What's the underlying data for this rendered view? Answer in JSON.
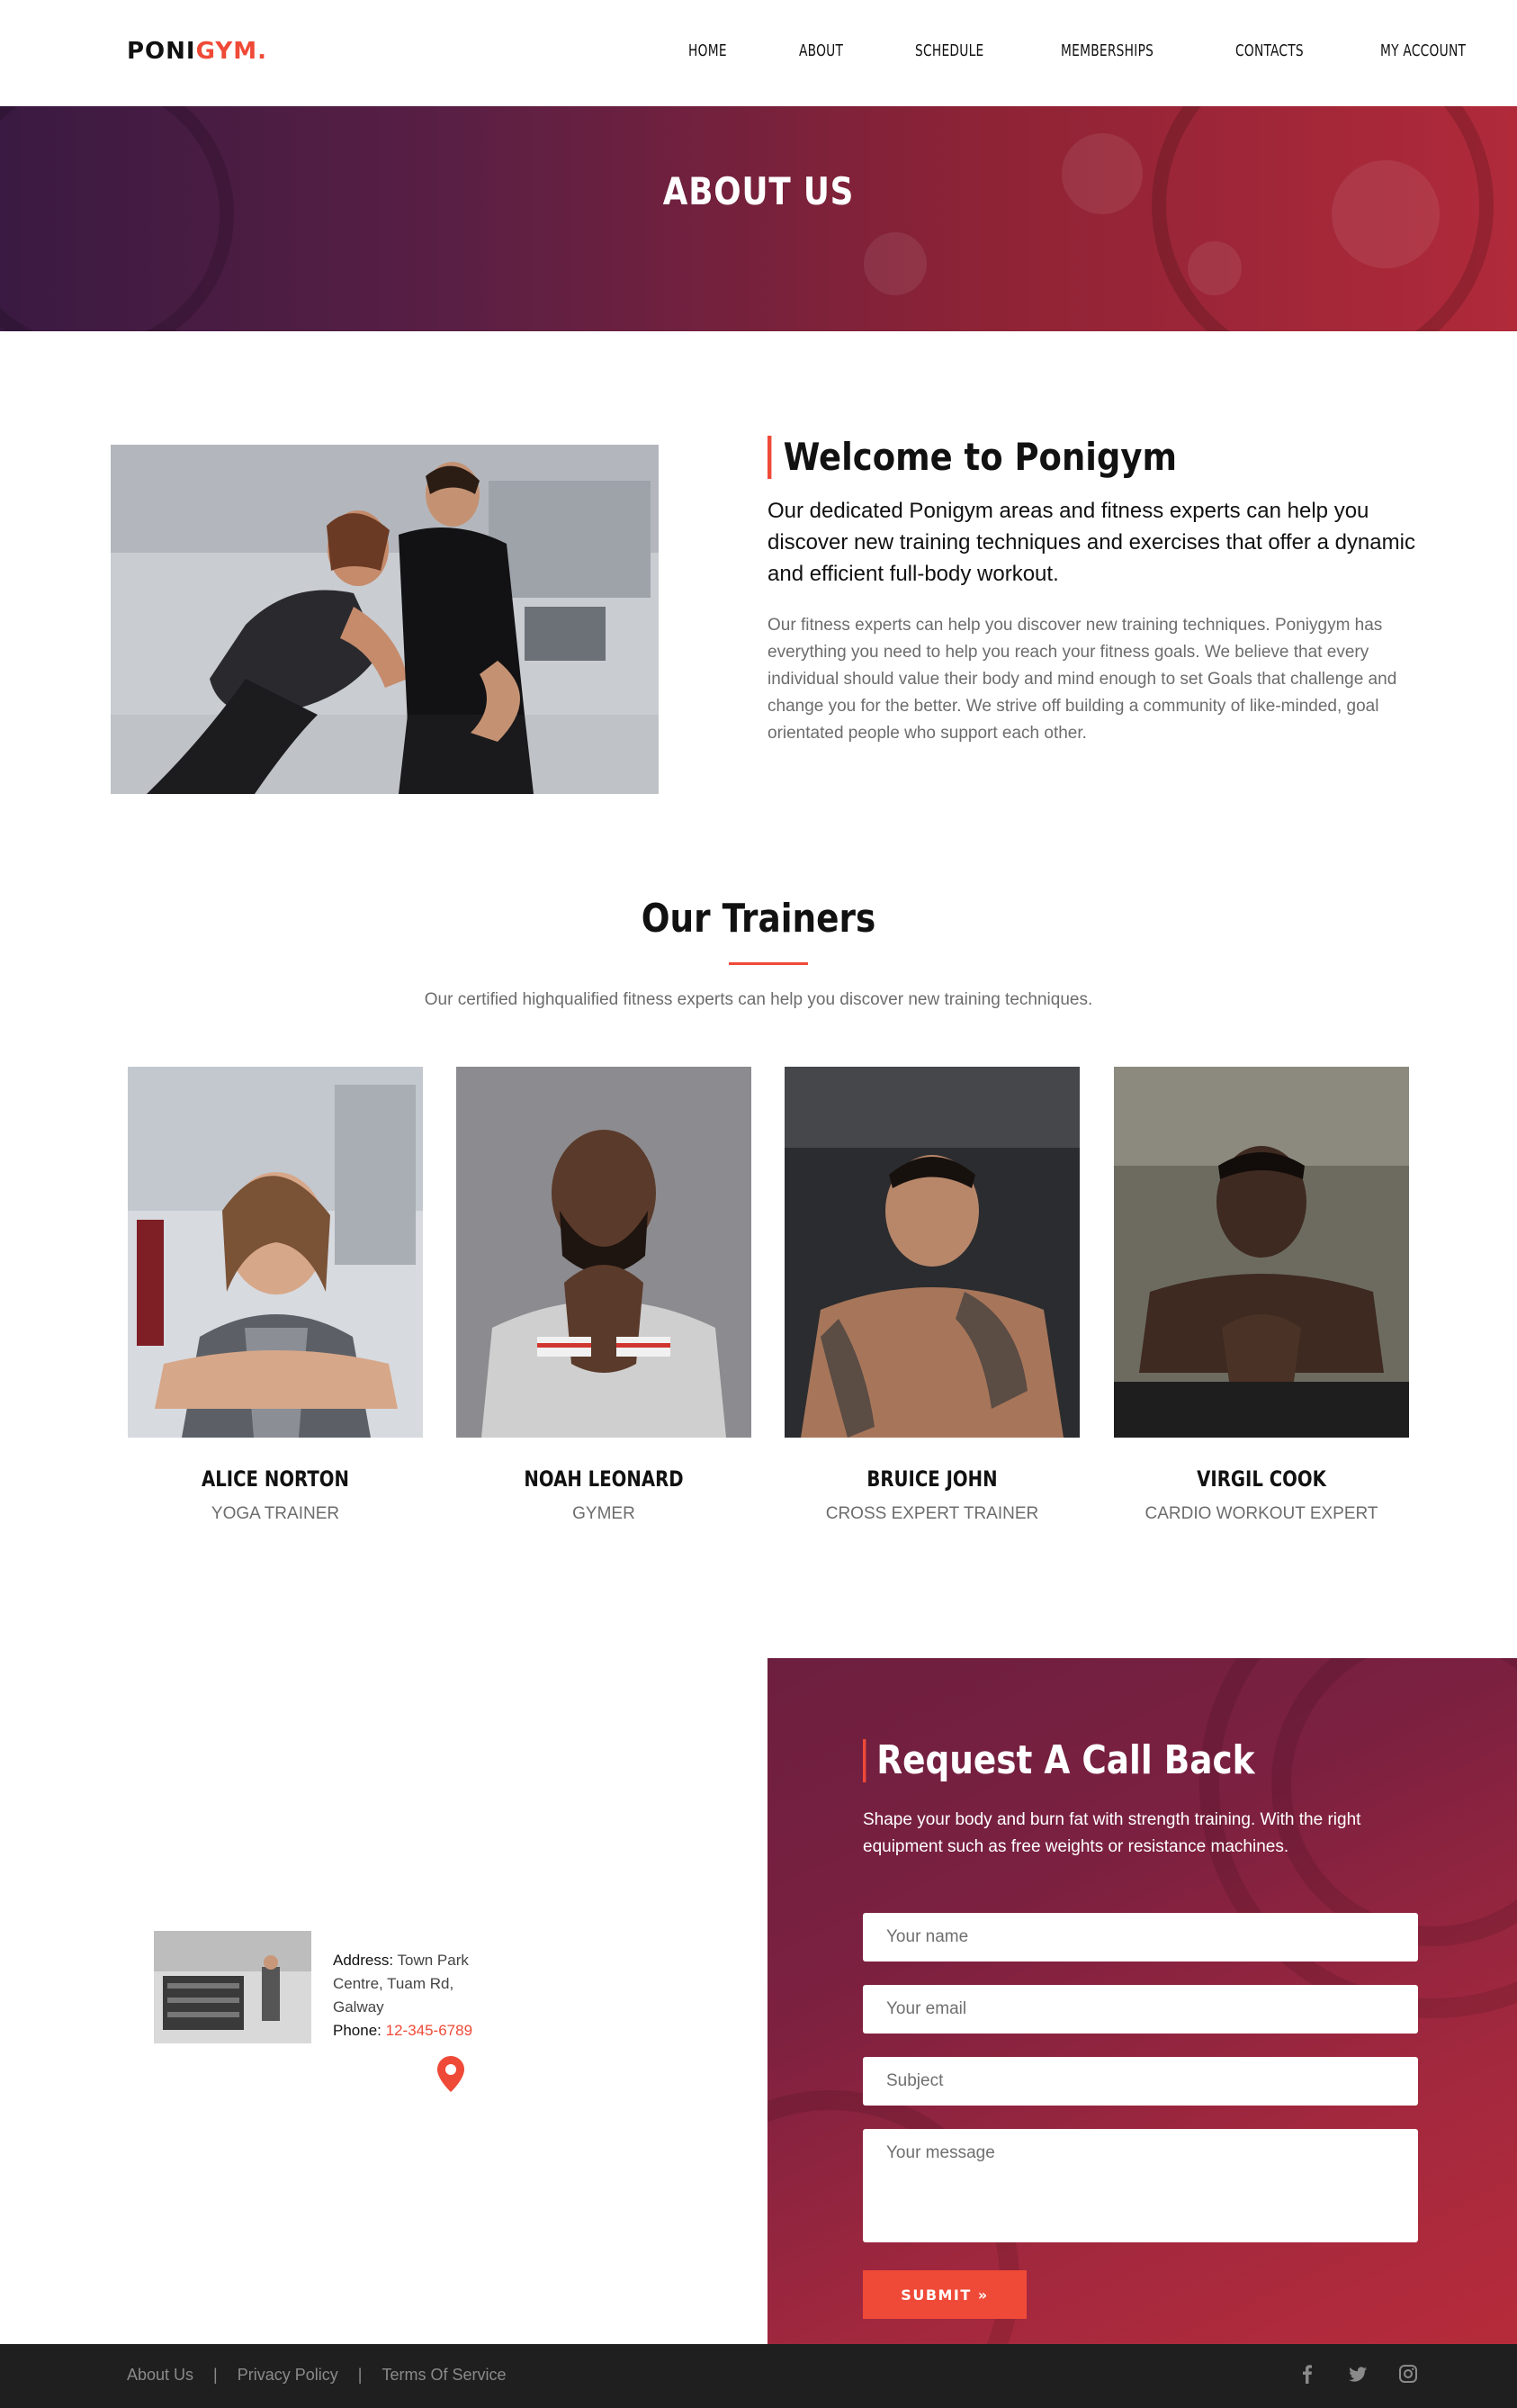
{
  "nav": {
    "logo_main": "PONI",
    "logo_accent": "GYM.",
    "items": [
      "HOME",
      "ABOUT",
      "SCHEDULE",
      "MEMBERSHIPS",
      "CONTACTS",
      "MY ACCOUNT"
    ]
  },
  "hero": {
    "title": "ABOUT US"
  },
  "welcome": {
    "title": "Welcome to Ponigym",
    "lead": "Our dedicated Ponigym areas and fitness experts can help you discover new training techniques and exercises that offer a dynamic and efficient full-body workout.",
    "body": "Our fitness experts can help you discover new training techniques. Poniygym has everything you need to help you reach your fitness goals. We believe that every individual should value their body and mind enough to set Goals that challenge and change you for the better. We strive off building a community of like-minded, goal orientated people who support each other."
  },
  "trainers": {
    "title": "Our Trainers",
    "subtitle": "Our certified highqualified fitness experts can help you discover new training techniques.",
    "list": [
      {
        "name": "ALICE NORTON",
        "role": "YOGA TRAINER"
      },
      {
        "name": "NOAH LEONARD",
        "role": "GYMER"
      },
      {
        "name": "BRUICE JOHN",
        "role": "CROSS EXPERT TRAINER"
      },
      {
        "name": "VIRGIL COOK",
        "role": "CARDIO WORKOUT EXPERT"
      }
    ]
  },
  "contact": {
    "address_label": "Address:",
    "address_value": "Town Park Centre, Tuam Rd, Galway",
    "phone_label": "Phone:",
    "phone_value": "12-345-6789"
  },
  "callback": {
    "title": "Request A Call Back",
    "description": "Shape your body and burn fat with strength training. With the right equipment such as free weights or resistance machines.",
    "name_placeholder": "Your name",
    "email_placeholder": "Your email",
    "subject_placeholder": "Subject",
    "message_placeholder": "Your message",
    "submit_label": "SUBMIT »"
  },
  "footer": {
    "links": [
      "About Us",
      "Privacy Policy",
      "Terms Of Service"
    ],
    "social_icons": [
      "facebook-icon",
      "twitter-icon",
      "instagram-icon"
    ]
  },
  "colors": {
    "accent": "#ef4a37",
    "hero_gradient_start": "#3a1a42",
    "hero_gradient_end": "#b02a3a",
    "footer_bg": "#1f1f1f"
  }
}
